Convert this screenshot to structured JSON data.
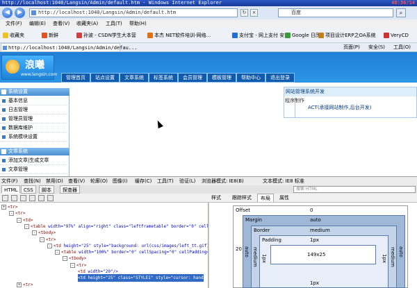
{
  "window": {
    "title": "http://localhost:1040/Langsin/Admin/default.htm - Windows Internet Explorer",
    "clock": "48:36/14"
  },
  "address": {
    "back_label": "◀",
    "forward_label": "▶",
    "url": "http://localhost:1040/Langsin/Admin/default.htm",
    "refresh_label": "↻",
    "stop_label": "×",
    "search_placeholder": "百度",
    "search_label": "⌕"
  },
  "menu": [
    "文件(F)",
    "编辑(E)",
    "查看(V)",
    "收藏夹(A)",
    "工具(T)",
    "帮助(H)"
  ],
  "favorites": [
    {
      "label": "收藏夹",
      "color": "#f0c020"
    },
    {
      "label": "新鲜",
      "color": "#e05020"
    },
    {
      "label": "孙波 - CSDN学生大本营",
      "color": "#d04040"
    },
    {
      "label": "本杰 NET软件培训-网络...",
      "color": "#e07010"
    },
    {
      "label": "支付宝 - 网上支付 安...",
      "color": "#1f6fd0"
    },
    {
      "label": "Google 日历",
      "color": "#3a9a3a"
    },
    {
      "label": "项目设计ERP之OA系统",
      "color": "#c08020"
    },
    {
      "label": "VeryCD",
      "color": "#d03030"
    }
  ],
  "tab": {
    "label": "http://localhost:1040/Langsin/Admin/defau..."
  },
  "commands": [
    "页面(P)",
    "安全(S)",
    "工具(O)"
  ],
  "site": {
    "logo_text": "浪曦",
    "logo_url": "www.langsin.com",
    "nav": [
      "管理首页",
      "站点设置",
      "文章系统",
      "标签系统",
      "会员管理",
      "模板管理",
      "帮助中心",
      "退出登录"
    ],
    "sidebar": {
      "group1": "系统设置",
      "items1": [
        "基本信息",
        "日志管理",
        "管理员管理",
        "数据库维护",
        "系统模块设置"
      ],
      "group2": "文章系统",
      "items2": [
        "添加文章|生成文章",
        "文章管理"
      ]
    },
    "info": {
      "heading": "网站管理系统开发",
      "label": "程序制作",
      "value": "ACT(承接网站制作,后台开发)"
    }
  },
  "devtools": {
    "menu": [
      "文件(F)",
      "查找(N)",
      "禁用(D)",
      "查看(V)",
      "轮廓(O)",
      "图像(I)",
      "缓存(C)",
      "工具(T)",
      "验证(L)",
      "浏览器模式: IE8(B)",
      "文本模式: IE8 标准"
    ],
    "tabs": [
      "HTML",
      "CSS",
      "脚本",
      "探查器"
    ],
    "search_placeholder": "搜索 HTML",
    "style_tabs": [
      "样式",
      "跟踪样式",
      "布局",
      "属性"
    ],
    "tree": [
      {
        "indent": 0,
        "tog": "+",
        "tag": "<tr>",
        "rest": ""
      },
      {
        "indent": 1,
        "tog": "-",
        "tag": "<tr>",
        "rest": ""
      },
      {
        "indent": 2,
        "tog": "-",
        "tag": "<td>",
        "rest": ""
      },
      {
        "indent": 3,
        "tog": "-",
        "tag": "<table",
        "rest": " width=\"97%\" align=\"right\" class=\"leftframetable\" border=\"0\" cellSpa"
      },
      {
        "indent": 4,
        "tog": "-",
        "tag": "<tbody>",
        "rest": ""
      },
      {
        "indent": 5,
        "tog": "-",
        "tag": "<tr>",
        "rest": ""
      },
      {
        "indent": 6,
        "tog": "-",
        "tag": "<td",
        "rest": " height=\"25\" style=\"background: url(css/images/left_tt.gif)"
      },
      {
        "indent": 7,
        "tog": "-",
        "tag": "<table",
        "rest": " width=\"100%\" border=\"0\" cellSpacing=\"0\" cellPadding=\""
      },
      {
        "indent": 8,
        "tog": "-",
        "tag": "<tbody>",
        "rest": ""
      },
      {
        "indent": 9,
        "tog": "-",
        "tag": "<tr>",
        "rest": ""
      },
      {
        "indent": 10,
        "tog": "",
        "tag": "<td",
        "rest": " width=\"20\"/>"
      },
      {
        "indent": 10,
        "tog": "",
        "tag": "<td",
        "rest": " height=\"25\" class=\"STYLE1\" style=\"cursor: hand"
      },
      {
        "indent": 2,
        "tog": "+",
        "tag": "<tr>",
        "rest": ""
      }
    ],
    "layout": {
      "offset_label": "Offset",
      "offset_value": "0",
      "margin_label": "Margin",
      "margin_value": "auto",
      "border_label": "Border",
      "border_value": "medium",
      "padding_label": "Padding",
      "padding_value": "1px",
      "content_size": "149x25",
      "left_offset": "20",
      "left_margin": "auto",
      "left_border": "medium",
      "left_padding": "1px",
      "right_padding": "1px",
      "right_border": "medium",
      "right_margin": "auto",
      "bottom_padding": "1px"
    }
  }
}
